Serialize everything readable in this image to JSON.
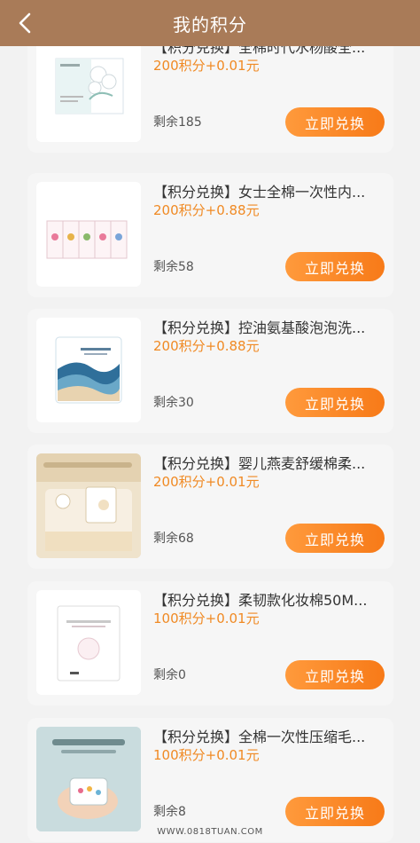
{
  "header": {
    "title": "我的积分",
    "back_icon": "chevron-left-icon"
  },
  "items": [
    {
      "title": "【积分兑换】全棉时代水杨酸全...",
      "price": "200积分+0.01元",
      "stock": "剩余185",
      "button": "立即兑换"
    },
    {
      "title": "【积分兑换】女士全棉一次性内...",
      "price": "200积分+0.88元",
      "stock": "剩余58",
      "button": "立即兑换"
    },
    {
      "title": "【积分兑换】控油氨基酸泡泡洗...",
      "price": "200积分+0.88元",
      "stock": "剩余30",
      "button": "立即兑换"
    },
    {
      "title": "【积分兑换】婴儿燕麦舒缓棉柔...",
      "price": "200积分+0.01元",
      "stock": "剩余68",
      "button": "立即兑换"
    },
    {
      "title": "【积分兑换】柔韧款化妆棉50M...",
      "price": "100积分+0.01元",
      "stock": "剩余0",
      "button": "立即兑换"
    },
    {
      "title": "【积分兑换】全棉一次性压缩毛...",
      "price": "100积分+0.01元",
      "stock": "剩余8",
      "button": "立即兑换"
    }
  ],
  "watermark": "WWW.0818TUAN.COM",
  "colors": {
    "header_bg": "#a97b58",
    "accent": "#f08a24",
    "button_gradient_start": "#ff9a3c",
    "button_gradient_end": "#f77a18"
  }
}
